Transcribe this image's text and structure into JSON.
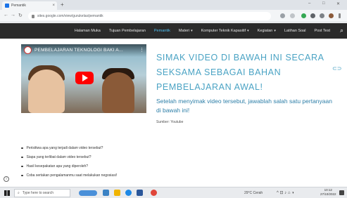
{
  "browser": {
    "tab_title": "Pemantik",
    "new_tab": "+",
    "url": "sites.google.com/view/gurukelas/pemantik",
    "window_controls": [
      "–",
      "□",
      "✕"
    ]
  },
  "site_nav": {
    "items": [
      {
        "label": "Halaman Muka",
        "dropdown": false,
        "active": false
      },
      {
        "label": "Tujuan Pembelajaran",
        "dropdown": false,
        "active": false
      },
      {
        "label": "Pemantik",
        "dropdown": false,
        "active": true
      },
      {
        "label": "Materi",
        "dropdown": true,
        "active": false
      },
      {
        "label": "Komputer Teknik Kapasitif",
        "dropdown": true,
        "active": false
      },
      {
        "label": "Kegiatan",
        "dropdown": true,
        "active": false
      },
      {
        "label": "Latihan Soal",
        "dropdown": false,
        "active": false
      },
      {
        "label": "Post Test",
        "dropdown": false,
        "active": false
      }
    ],
    "accent": "#4fc3f7"
  },
  "video": {
    "title": "PEMBELAJARAN TEKNOLOGI BAKI A..."
  },
  "content": {
    "headline": "SIMAK VIDEO DI BAWAH INI SECARA SEKSAMA SEBAGAI BAHAN PEMBELAJARAN AWAL!",
    "subtext": "Setelah menyimak video tersebut, jawablah salah satu pertanyaan di bawah ini!",
    "source": "Sumber: Youtube",
    "questions": [
      "Perisitiwa apa yang terjadi dalam video tersebut?",
      "Siapa yang terlibat dalam video tersebut?",
      "Hasil kesepakatan apa yang diperoleh?",
      "Coba sertakan pengalamanmu saat melakukan negosiasi!"
    ],
    "heading_color": "#4aa3c4"
  },
  "taskbar": {
    "search_placeholder": "Type here to search",
    "weather": "29°C Cerah",
    "time": "10:12",
    "date": "27/10/2022"
  }
}
